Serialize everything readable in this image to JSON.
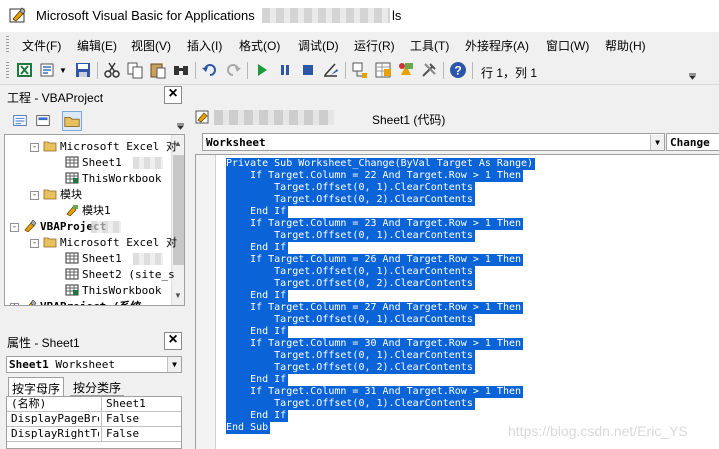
{
  "window": {
    "title": "Microsoft Visual Basic for Applications",
    "title_suffix": "ls"
  },
  "menu": [
    "文件(F)",
    "编辑(E)",
    "视图(V)",
    "插入(I)",
    "格式(O)",
    "调试(D)",
    "运行(R)",
    "工具(T)",
    "外接程序(A)",
    "窗口(W)",
    "帮助(H)"
  ],
  "toolbar": {
    "cursor_position": "行 1，列 1",
    "icons": [
      "excel-icon",
      "insert-module-icon",
      "save-icon",
      "cut-icon",
      "copy-icon",
      "paste-icon",
      "find-icon",
      "undo-icon",
      "redo-icon",
      "run-icon",
      "break-icon",
      "reset-icon",
      "design-mode-icon",
      "project-explorer-icon",
      "properties-window-icon",
      "object-browser-icon",
      "toolbox-icon",
      "help-icon"
    ]
  },
  "project_pane": {
    "title": "工程 - VBAProject",
    "tree": [
      {
        "label": "Microsoft Excel 对",
        "level": 1,
        "kind": "folder",
        "expander": "-"
      },
      {
        "label": "Sheet1",
        "level": 2,
        "kind": "sheet",
        "blur": true
      },
      {
        "label": "ThisWorkbook",
        "level": 2,
        "kind": "workbook"
      },
      {
        "label": "模块",
        "level": 1,
        "kind": "folder",
        "expander": "-"
      },
      {
        "label": "模块1",
        "level": 2,
        "kind": "module"
      },
      {
        "label": "VBAProject",
        "level": 0,
        "kind": "project",
        "expander": "-",
        "bold": true,
        "blur": true
      },
      {
        "label": "Microsoft Excel 对",
        "level": 1,
        "kind": "folder",
        "expander": "-"
      },
      {
        "label": "Sheet1",
        "level": 2,
        "kind": "sheet",
        "blur": true
      },
      {
        "label": "Sheet2 (site_s",
        "level": 2,
        "kind": "sheet"
      },
      {
        "label": "ThisWorkbook",
        "level": 2,
        "kind": "workbook"
      },
      {
        "label": "VBAProject (系统",
        "level": 0,
        "kind": "project",
        "expander": "+",
        "bold": true
      }
    ]
  },
  "properties_pane": {
    "title": "属性 - Sheet1",
    "object_name": "Sheet1",
    "object_type": "Worksheet",
    "tabs": [
      "按字母序",
      "按分类序"
    ],
    "rows": [
      {
        "name": "(名称)",
        "value": "Sheet1"
      },
      {
        "name": "DisplayPageBre",
        "value": "False"
      },
      {
        "name": "DisplayRightTo",
        "value": "False"
      }
    ]
  },
  "code_window": {
    "title": "Sheet1 (代码)",
    "object_combo": "Worksheet",
    "procedure_combo": "Change",
    "lines": [
      "Private Sub Worksheet_Change(ByVal Target As Range)",
      "    If Target.Column = 22 And Target.Row > 1 Then",
      "        Target.Offset(0, 1).ClearContents",
      "        Target.Offset(0, 2).ClearContents",
      "    End If",
      "    If Target.Column = 23 And Target.Row > 1 Then",
      "        Target.Offset(0, 1).ClearContents",
      "    End If",
      "    If Target.Column = 26 And Target.Row > 1 Then",
      "        Target.Offset(0, 1).ClearContents",
      "        Target.Offset(0, 2).ClearContents",
      "    End If",
      "    If Target.Column = 27 And Target.Row > 1 Then",
      "        Target.Offset(0, 1).ClearContents",
      "    End If",
      "    If Target.Column = 30 And Target.Row > 1 Then",
      "        Target.Offset(0, 1).ClearContents",
      "        Target.Offset(0, 2).ClearContents",
      "    End If",
      "    If Target.Column = 31 And Target.Row > 1 Then",
      "        Target.Offset(0, 1).ClearContents",
      "    End If",
      "End Sub"
    ]
  },
  "watermark": "https://blog.csdn.net/Eric_YS",
  "colors": {
    "selection": "#0a64d8",
    "selection_text": "#ffffff"
  }
}
